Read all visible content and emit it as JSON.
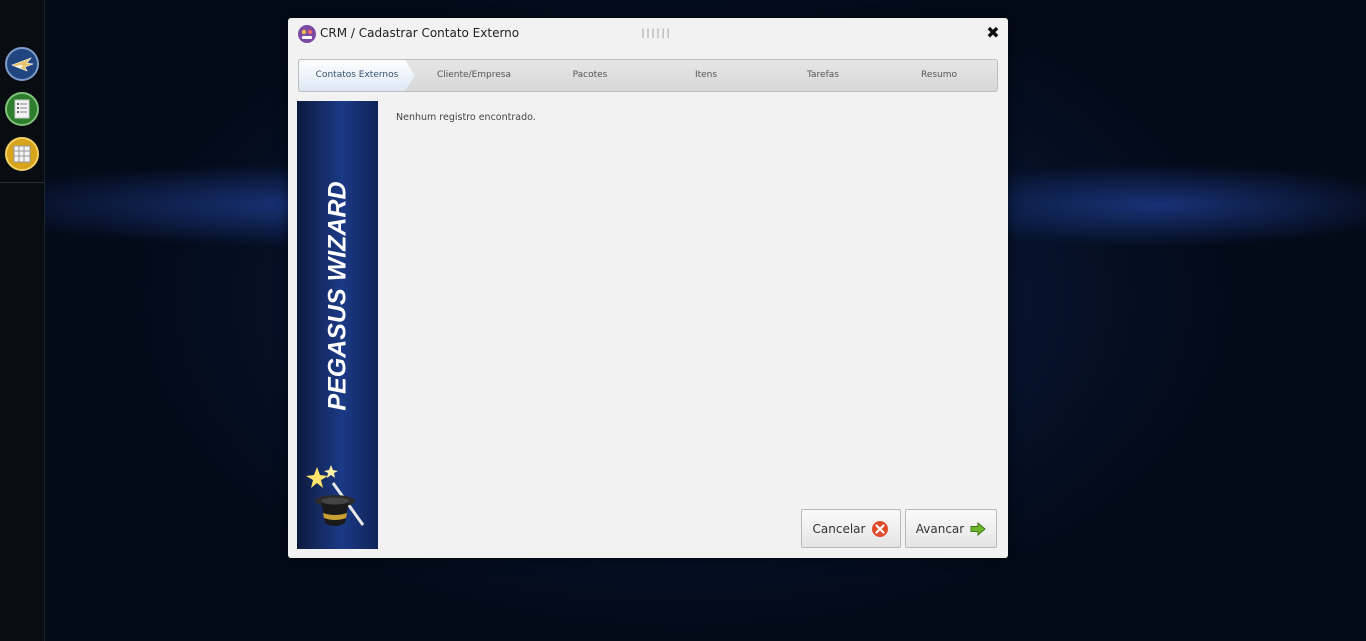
{
  "launcher": {
    "apps": [
      {
        "icon": "pegasus-wing-icon"
      },
      {
        "icon": "document-list-icon"
      },
      {
        "icon": "grid-table-icon"
      }
    ]
  },
  "dialog": {
    "title": "CRM / Cadastrar Contato Externo",
    "logo_icon": "crm-logo-icon",
    "close_icon": "close-icon",
    "drag_handle": "||||||"
  },
  "wizard": {
    "steps": [
      {
        "label": "Contatos Externos",
        "active": true
      },
      {
        "label": "Cliente/Empresa",
        "active": false
      },
      {
        "label": "Pacotes",
        "active": false
      },
      {
        "label": "Itens",
        "active": false
      },
      {
        "label": "Tarefas",
        "active": false
      },
      {
        "label": "Resumo",
        "active": false
      }
    ],
    "banner_text": "PEGASUS WIZARD",
    "empty_message": "Nenhum registro encontrado."
  },
  "buttons": {
    "cancel_label": "Cancelar",
    "next_label": "Avancar"
  },
  "colors": {
    "active_step_text": "#39516e",
    "banner_blue": "#1b3a86",
    "cancel_icon": "#e04a2a",
    "next_icon": "#6db52a"
  }
}
